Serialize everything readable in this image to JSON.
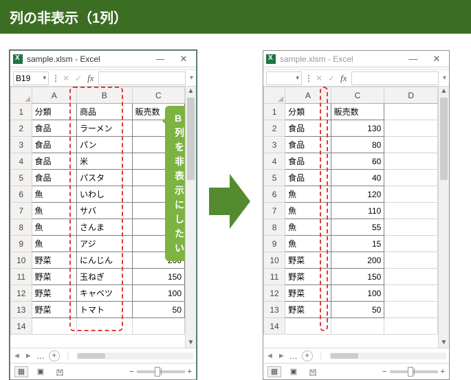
{
  "title": "列の非表示（1列）",
  "callout": "B列を非表示にしたい",
  "window": {
    "title": "sample.xlsm - Excel",
    "minimize": "—",
    "close": "✕"
  },
  "formula": {
    "namebox_left": "B19",
    "namebox_right": "",
    "fx": "fx"
  },
  "columns_left": [
    "A",
    "B",
    "C"
  ],
  "columns_right": [
    "A",
    "C",
    "D"
  ],
  "headers": {
    "a": "分類",
    "b": "商品",
    "c": "販売数"
  },
  "rows": [
    {
      "a": "食品",
      "b": "ラーメン",
      "c": 130
    },
    {
      "a": "食品",
      "b": "パン",
      "c": 80
    },
    {
      "a": "食品",
      "b": "米",
      "c": 60
    },
    {
      "a": "食品",
      "b": "パスタ",
      "c": 40
    },
    {
      "a": "魚",
      "b": "いわし",
      "c": 120
    },
    {
      "a": "魚",
      "b": "サバ",
      "c": 110
    },
    {
      "a": "魚",
      "b": "さんま",
      "c": 55
    },
    {
      "a": "魚",
      "b": "アジ",
      "c": 15
    },
    {
      "a": "野菜",
      "b": "にんじん",
      "c": 200
    },
    {
      "a": "野菜",
      "b": "玉ねぎ",
      "c": 150
    },
    {
      "a": "野菜",
      "b": "キャベツ",
      "c": 100
    },
    {
      "a": "野菜",
      "b": "トマト",
      "c": 50
    }
  ],
  "sheet_tabs": {
    "dots": "…",
    "plus": "+"
  },
  "zoom": {
    "minus": "−",
    "plus": "+"
  }
}
